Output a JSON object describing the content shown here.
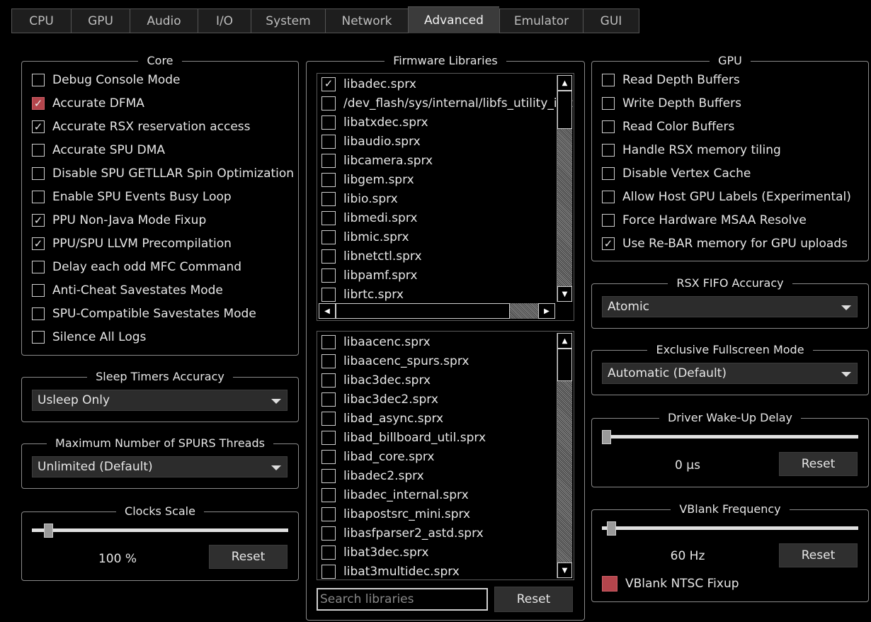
{
  "tabs": [
    "CPU",
    "GPU",
    "Audio",
    "I/O",
    "System",
    "Network",
    "Advanced",
    "Emulator",
    "GUI"
  ],
  "active_tab": "Advanced",
  "core": {
    "title": "Core",
    "items": [
      {
        "label": "Debug Console Mode",
        "checked": false,
        "style": "normal"
      },
      {
        "label": "Accurate DFMA",
        "checked": true,
        "style": "red"
      },
      {
        "label": "Accurate RSX reservation access",
        "checked": true,
        "style": "normal"
      },
      {
        "label": "Accurate SPU DMA",
        "checked": false,
        "style": "normal"
      },
      {
        "label": "Disable SPU GETLLAR Spin Optimization",
        "checked": false,
        "style": "normal"
      },
      {
        "label": "Enable SPU Events Busy Loop",
        "checked": false,
        "style": "normal"
      },
      {
        "label": "PPU Non-Java Mode Fixup",
        "checked": true,
        "style": "normal"
      },
      {
        "label": "PPU/SPU LLVM Precompilation",
        "checked": true,
        "style": "normal"
      },
      {
        "label": "Delay each odd MFC Command",
        "checked": false,
        "style": "normal"
      },
      {
        "label": "Anti-Cheat Savestates Mode",
        "checked": false,
        "style": "normal"
      },
      {
        "label": "SPU-Compatible Savestates Mode",
        "checked": false,
        "style": "normal"
      },
      {
        "label": "Silence All Logs",
        "checked": false,
        "style": "normal"
      }
    ]
  },
  "sleep_timers": {
    "title": "Sleep Timers Accuracy",
    "value": "Usleep Only"
  },
  "spurs_threads": {
    "title": "Maximum Number of SPURS Threads",
    "value": "Unlimited (Default)"
  },
  "clocks_scale": {
    "title": "Clocks Scale",
    "value_text": "100 %",
    "reset_label": "Reset",
    "level": 0.05
  },
  "firmware": {
    "title": "Firmware Libraries",
    "top_list": [
      {
        "label": "libadec.sprx",
        "checked": true
      },
      {
        "label": "/dev_flash/sys/internal/libfs_utility_init",
        "checked": false
      },
      {
        "label": "libatxdec.sprx",
        "checked": false
      },
      {
        "label": "libaudio.sprx",
        "checked": false
      },
      {
        "label": "libcamera.sprx",
        "checked": false
      },
      {
        "label": "libgem.sprx",
        "checked": false
      },
      {
        "label": "libio.sprx",
        "checked": false
      },
      {
        "label": "libmedi.sprx",
        "checked": false
      },
      {
        "label": "libmic.sprx",
        "checked": false
      },
      {
        "label": "libnetctl.sprx",
        "checked": false
      },
      {
        "label": "libpamf.sprx",
        "checked": false
      },
      {
        "label": "librtc.sprx",
        "checked": false
      }
    ],
    "bottom_list": [
      {
        "label": "libaacenc.sprx",
        "checked": false
      },
      {
        "label": "libaacenc_spurs.sprx",
        "checked": false
      },
      {
        "label": "libac3dec.sprx",
        "checked": false
      },
      {
        "label": "libac3dec2.sprx",
        "checked": false
      },
      {
        "label": "libad_async.sprx",
        "checked": false
      },
      {
        "label": "libad_billboard_util.sprx",
        "checked": false
      },
      {
        "label": "libad_core.sprx",
        "checked": false
      },
      {
        "label": "libadec2.sprx",
        "checked": false
      },
      {
        "label": "libadec_internal.sprx",
        "checked": false
      },
      {
        "label": "libapostsrc_mini.sprx",
        "checked": false
      },
      {
        "label": "libasfparser2_astd.sprx",
        "checked": false
      },
      {
        "label": "libat3dec.sprx",
        "checked": false
      },
      {
        "label": "libat3multidec.sprx",
        "checked": false
      }
    ],
    "search_placeholder": "Search libraries",
    "reset_label": "Reset"
  },
  "gpu": {
    "title": "GPU",
    "items": [
      {
        "label": "Read Depth Buffers",
        "checked": false
      },
      {
        "label": "Write Depth Buffers",
        "checked": false
      },
      {
        "label": "Read Color Buffers",
        "checked": false
      },
      {
        "label": "Handle RSX memory tiling",
        "checked": false
      },
      {
        "label": "Disable Vertex Cache",
        "checked": false
      },
      {
        "label": "Allow Host GPU Labels (Experimental)",
        "checked": false
      },
      {
        "label": "Force Hardware MSAA Resolve",
        "checked": false
      },
      {
        "label": "Use Re-BAR memory for GPU uploads",
        "checked": true
      }
    ]
  },
  "rsx_fifo": {
    "title": "RSX FIFO Accuracy",
    "value": "Atomic"
  },
  "fullscreen": {
    "title": "Exclusive Fullscreen Mode",
    "value": "Automatic (Default)"
  },
  "driver_wakeup": {
    "title": "Driver Wake-Up Delay",
    "value_text": "0 µs",
    "reset_label": "Reset",
    "level": 0.0
  },
  "vblank": {
    "title": "VBlank Frequency",
    "value_text": "60 Hz",
    "reset_label": "Reset",
    "level": 0.02,
    "ntsc_label": "VBlank NTSC Fixup",
    "ntsc_checked": false
  },
  "colors": {
    "accent_red": "#b4454c",
    "background": "#000000",
    "text": "#e6e6e6"
  }
}
